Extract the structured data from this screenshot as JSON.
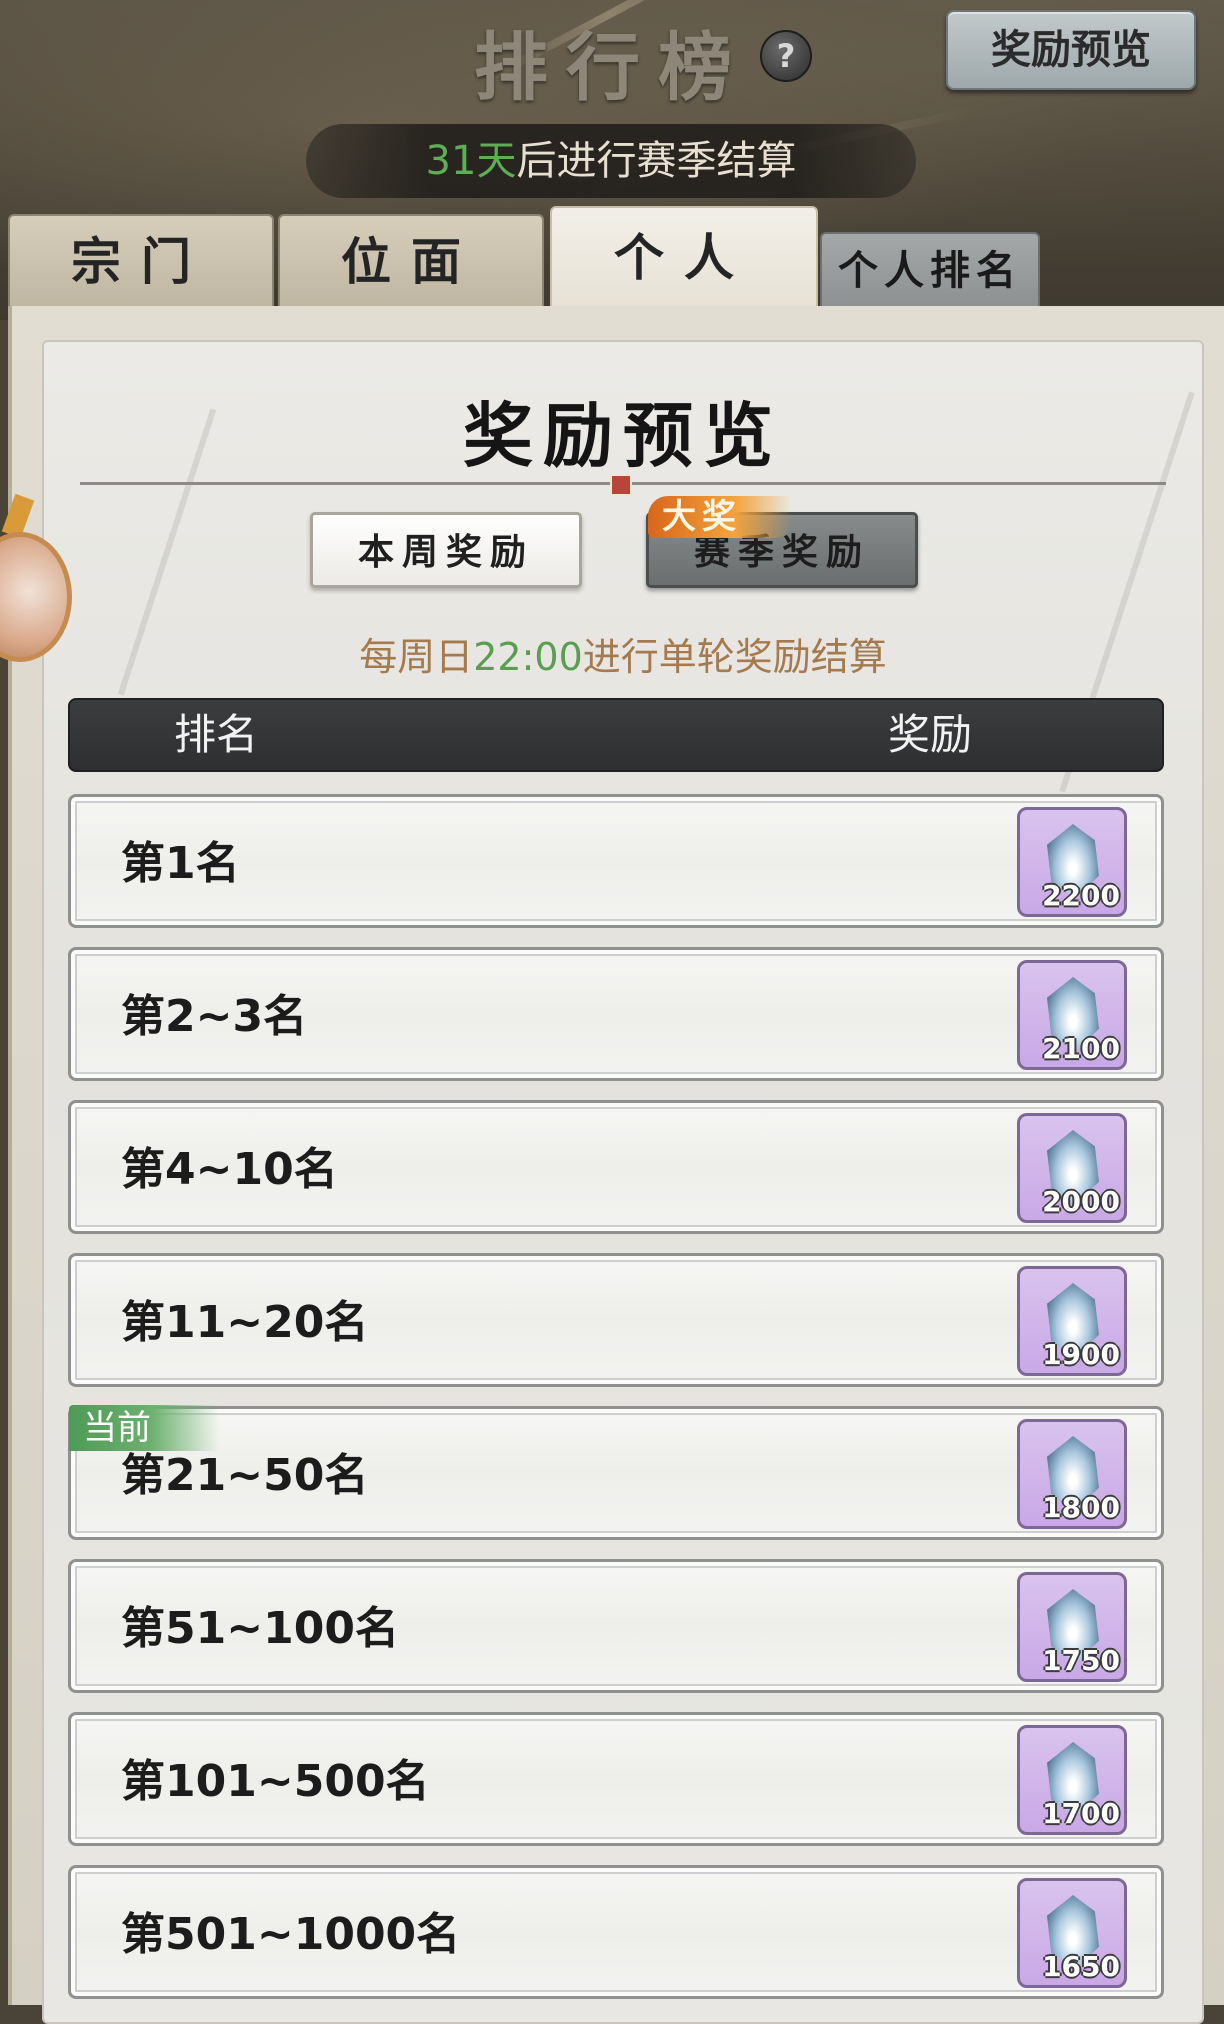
{
  "header": {
    "title": "排行榜",
    "help_icon": "?",
    "preview_button": "奖励预览",
    "season_days": "31天",
    "season_text": "后进行赛季结算"
  },
  "tabs": [
    {
      "label": "宗门",
      "active": false
    },
    {
      "label": "位面",
      "active": false
    },
    {
      "label": "个人",
      "active": true
    },
    {
      "label": "个人排名",
      "active": false
    }
  ],
  "dialog": {
    "title": "奖励预览",
    "weekly_button": "本周奖励",
    "season_button": "赛季奖励",
    "season_badge": "大奖",
    "settle_prefix": "每周日",
    "settle_time": "22:00",
    "settle_suffix": "进行单轮奖励结算",
    "col_rank": "排名",
    "col_reward": "奖励",
    "current_tag": "当前"
  },
  "rows": [
    {
      "rank": "第1名",
      "amount": "2200"
    },
    {
      "rank": "第2~3名",
      "amount": "2100"
    },
    {
      "rank": "第4~10名",
      "amount": "2000"
    },
    {
      "rank": "第11~20名",
      "amount": "1900"
    },
    {
      "rank": "第21~50名",
      "amount": "1800",
      "current": true
    },
    {
      "rank": "第51~100名",
      "amount": "1750"
    },
    {
      "rank": "第101~500名",
      "amount": "1700"
    },
    {
      "rank": "第501~1000名",
      "amount": "1650"
    }
  ],
  "colors": {
    "accent_green": "#5fae55",
    "note_brown": "#a57a4d",
    "reward_purple": "#c9a8e6",
    "badge_orange": "#f3a33b"
  }
}
